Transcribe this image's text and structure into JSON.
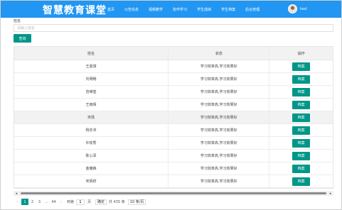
{
  "header": {
    "brand": "智慧教育课堂",
    "nav": [
      "首页",
      "公告信息",
      "视频教学",
      "协作学习",
      "学生成绩",
      "学生档案",
      "后台管理"
    ],
    "user_name": "test"
  },
  "search": {
    "label": "姓名",
    "placeholder": "请输入姓名",
    "button_label": "查询"
  },
  "table": {
    "columns": [
      "姓名",
      "状态",
      "操作"
    ],
    "rows": [
      {
        "name": "王嘉琪",
        "status": "学习效率高,学习效果好",
        "action": "档案"
      },
      {
        "name": "刘明畅",
        "status": "学习效率高,学习效果好",
        "action": "档案"
      },
      {
        "name": "范维莹",
        "status": "学习效率高,学习效果好",
        "action": "档案"
      },
      {
        "name": "王雨晴",
        "status": "学习效率高,学习效果好",
        "action": "档案"
      },
      {
        "name": "宋扬",
        "status": "学习效率高,学习效果好",
        "action": "档案"
      },
      {
        "name": "杨亦沛",
        "status": "学习效率高,学习效果好",
        "action": "档案"
      },
      {
        "name": "许玫秀",
        "status": "学习效率高,学习效果好",
        "action": "档案"
      },
      {
        "name": "陈心泽",
        "status": "学习效率高,学习效果好",
        "action": "档案"
      },
      {
        "name": "金耀森",
        "status": "学习效率高,学习效果好",
        "action": "档案"
      },
      {
        "name": "宋炳祥",
        "status": "学习效率高,学习效果好",
        "action": "档案"
      }
    ]
  },
  "pagination": {
    "prev": "‹",
    "pages": [
      "1",
      "2",
      "3"
    ],
    "ellipsis": "…",
    "last_page": "44",
    "next": "›",
    "goto_prefix": "到第",
    "goto_value": "1",
    "goto_suffix": "页",
    "confirm": "确定",
    "total": "共 435 条",
    "page_size": "10 条/页"
  }
}
